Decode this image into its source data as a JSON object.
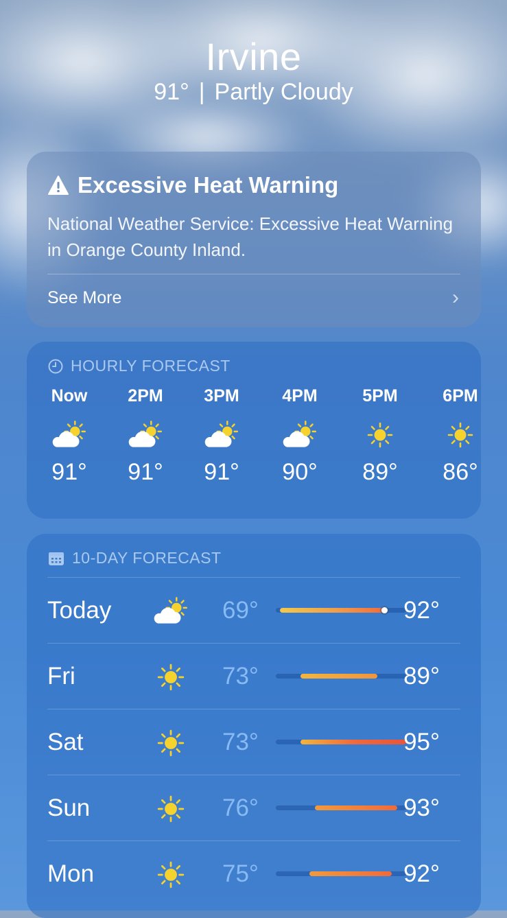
{
  "location": {
    "city": "Irvine",
    "current_temp": "91°",
    "separator": "|",
    "condition": "Partly Cloudy"
  },
  "alert": {
    "title": "Excessive Heat Warning",
    "text": "National Weather Service: Excessive Heat Warning in Orange County Inland.",
    "see_more": "See More",
    "icon": "warning-triangle-icon"
  },
  "hourly": {
    "title": "HOURLY FORECAST",
    "icon": "clock-icon",
    "hours": [
      {
        "time": "Now",
        "icon": "partly-cloudy-icon",
        "temp": "91°"
      },
      {
        "time": "2PM",
        "icon": "partly-cloudy-icon",
        "temp": "91°"
      },
      {
        "time": "3PM",
        "icon": "partly-cloudy-icon",
        "temp": "91°"
      },
      {
        "time": "4PM",
        "icon": "partly-cloudy-icon",
        "temp": "90°"
      },
      {
        "time": "5PM",
        "icon": "sun-icon",
        "temp": "89°"
      },
      {
        "time": "6PM",
        "icon": "sun-icon",
        "temp": "86°"
      }
    ]
  },
  "daily": {
    "title": "10-DAY FORECAST",
    "icon": "calendar-icon",
    "days": [
      {
        "day": "Today",
        "icon": "partly-cloudy-icon",
        "low": "69°",
        "high": "92°",
        "bar_start": 0.03,
        "bar_end": 0.86,
        "current": 0.83,
        "grad": [
          "#f2c94c",
          "#f0a04b",
          "#ef6a3c"
        ]
      },
      {
        "day": "Fri",
        "icon": "sun-icon",
        "low": "73°",
        "high": "89°",
        "bar_start": 0.19,
        "bar_end": 0.78,
        "grad": [
          "#f3b53d",
          "#f0953d"
        ]
      },
      {
        "day": "Sat",
        "icon": "sun-icon",
        "low": "73°",
        "high": "95°",
        "bar_start": 0.19,
        "bar_end": 1.0,
        "grad": [
          "#f3b53d",
          "#ef6a3c",
          "#e9553a"
        ]
      },
      {
        "day": "Sun",
        "icon": "sun-icon",
        "low": "76°",
        "high": "93°",
        "bar_start": 0.3,
        "bar_end": 0.93,
        "grad": [
          "#f29a3c",
          "#ef6a3c"
        ]
      },
      {
        "day": "Mon",
        "icon": "sun-icon",
        "low": "75°",
        "high": "92°",
        "bar_start": 0.26,
        "bar_end": 0.89,
        "grad": [
          "#f29a3c",
          "#ef6a3c"
        ]
      }
    ]
  },
  "colors": {
    "accent_low": "#8cbef5",
    "card_blue": "#2d6ec3",
    "sun": "#f6d22e"
  }
}
